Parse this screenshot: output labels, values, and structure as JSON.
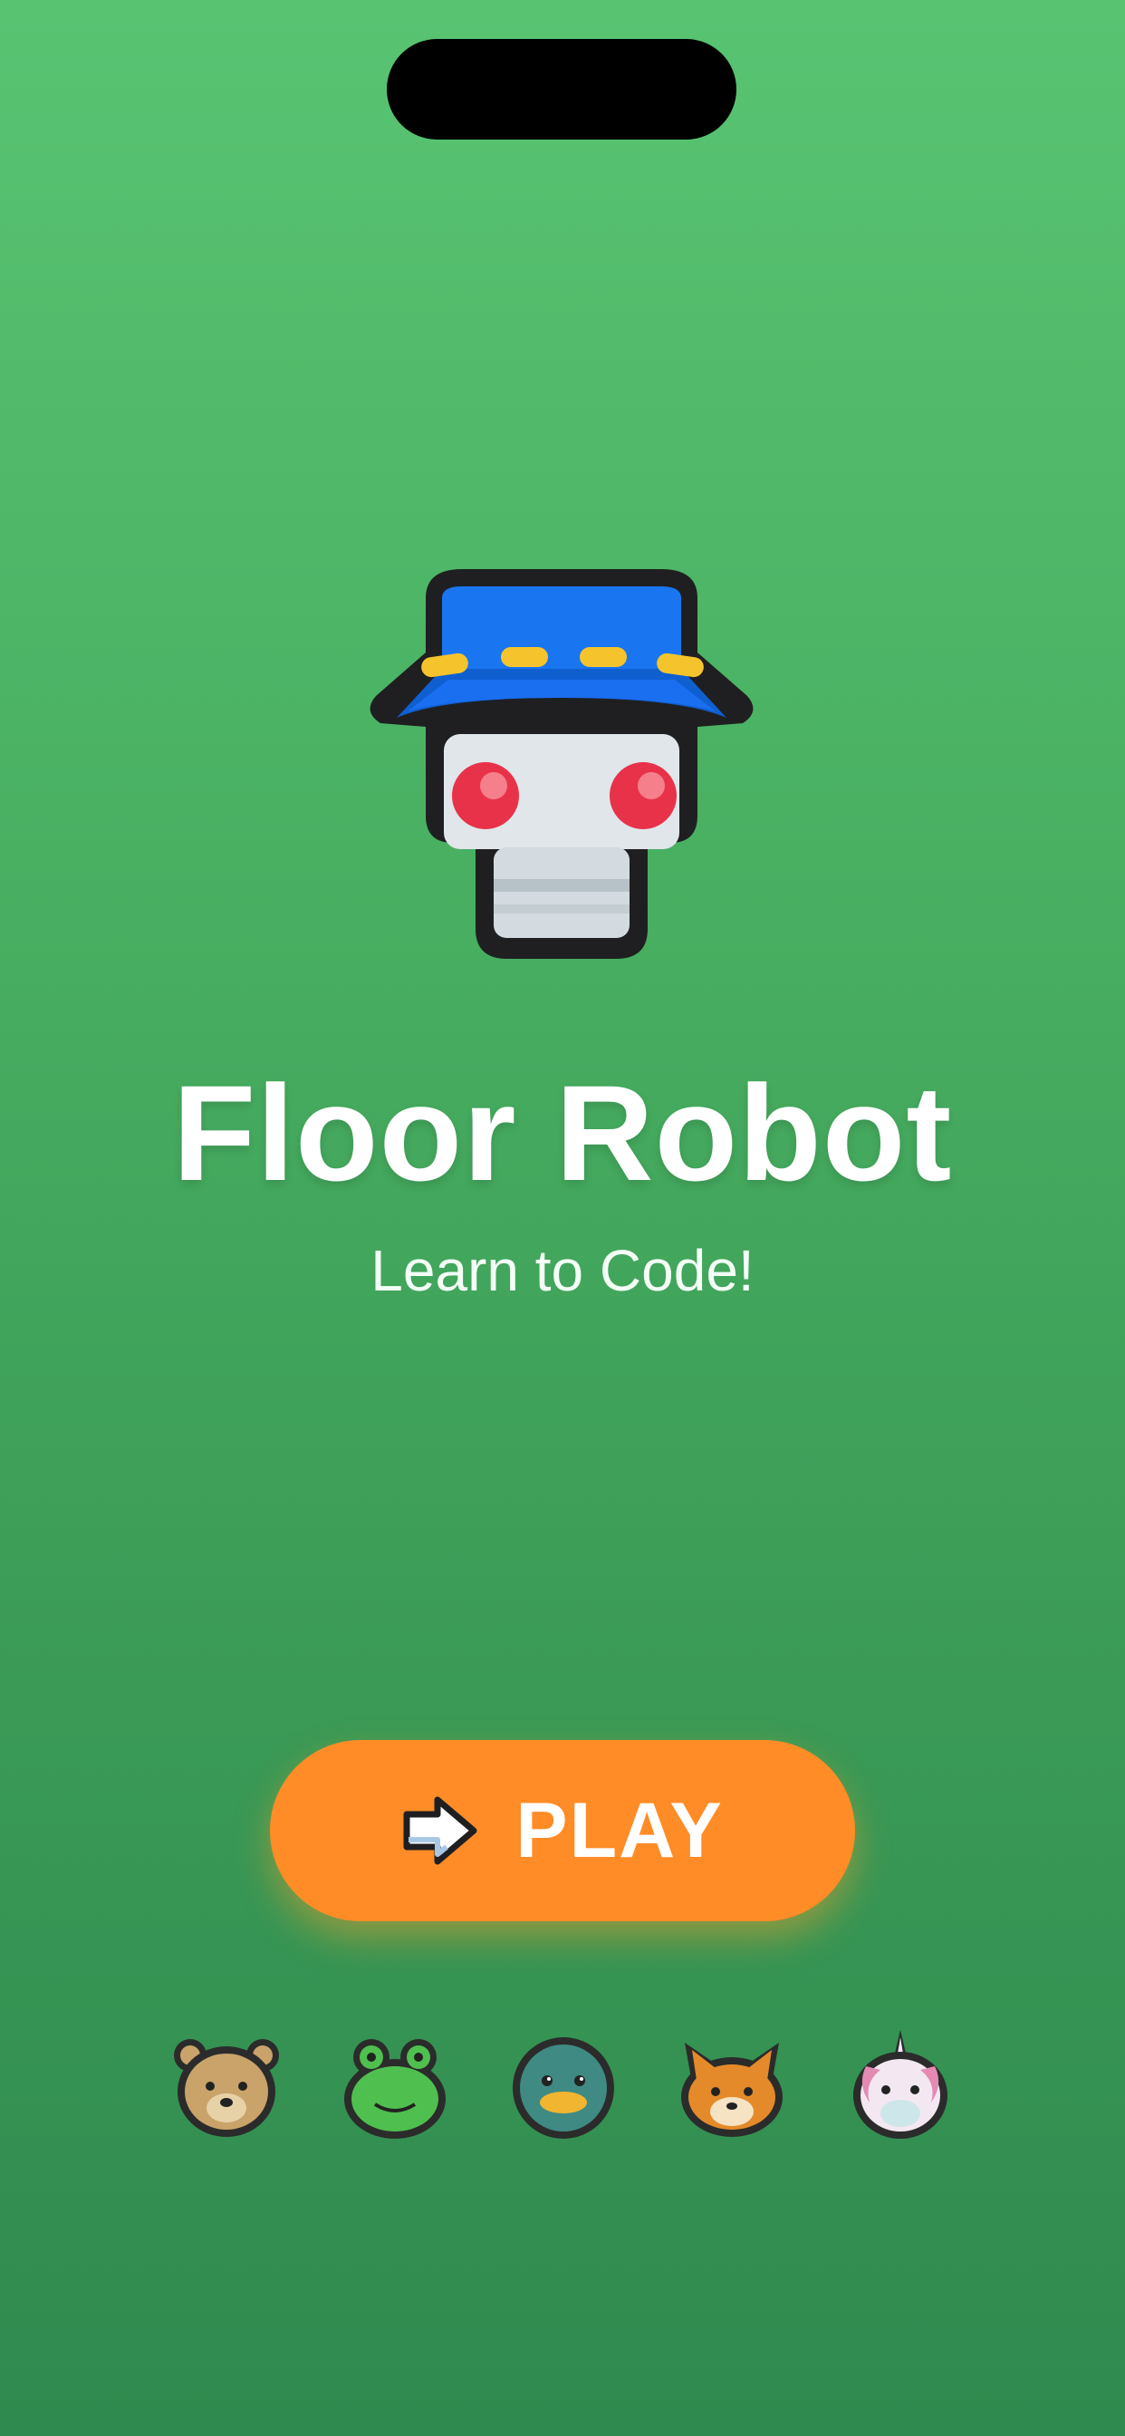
{
  "app": {
    "title": "Floor Robot",
    "subtitle": "Learn to Code!"
  },
  "play_button": {
    "label": "PLAY",
    "icon": "arrow-right-icon"
  },
  "characters": [
    "bear",
    "frog",
    "duck",
    "fox",
    "unicorn"
  ],
  "colors": {
    "background_top": "#58c472",
    "background_bottom": "#2f8a4f",
    "play_button": "#ff8c26",
    "robot_hat": "#1976f0",
    "robot_eyes": "#e8324a"
  }
}
